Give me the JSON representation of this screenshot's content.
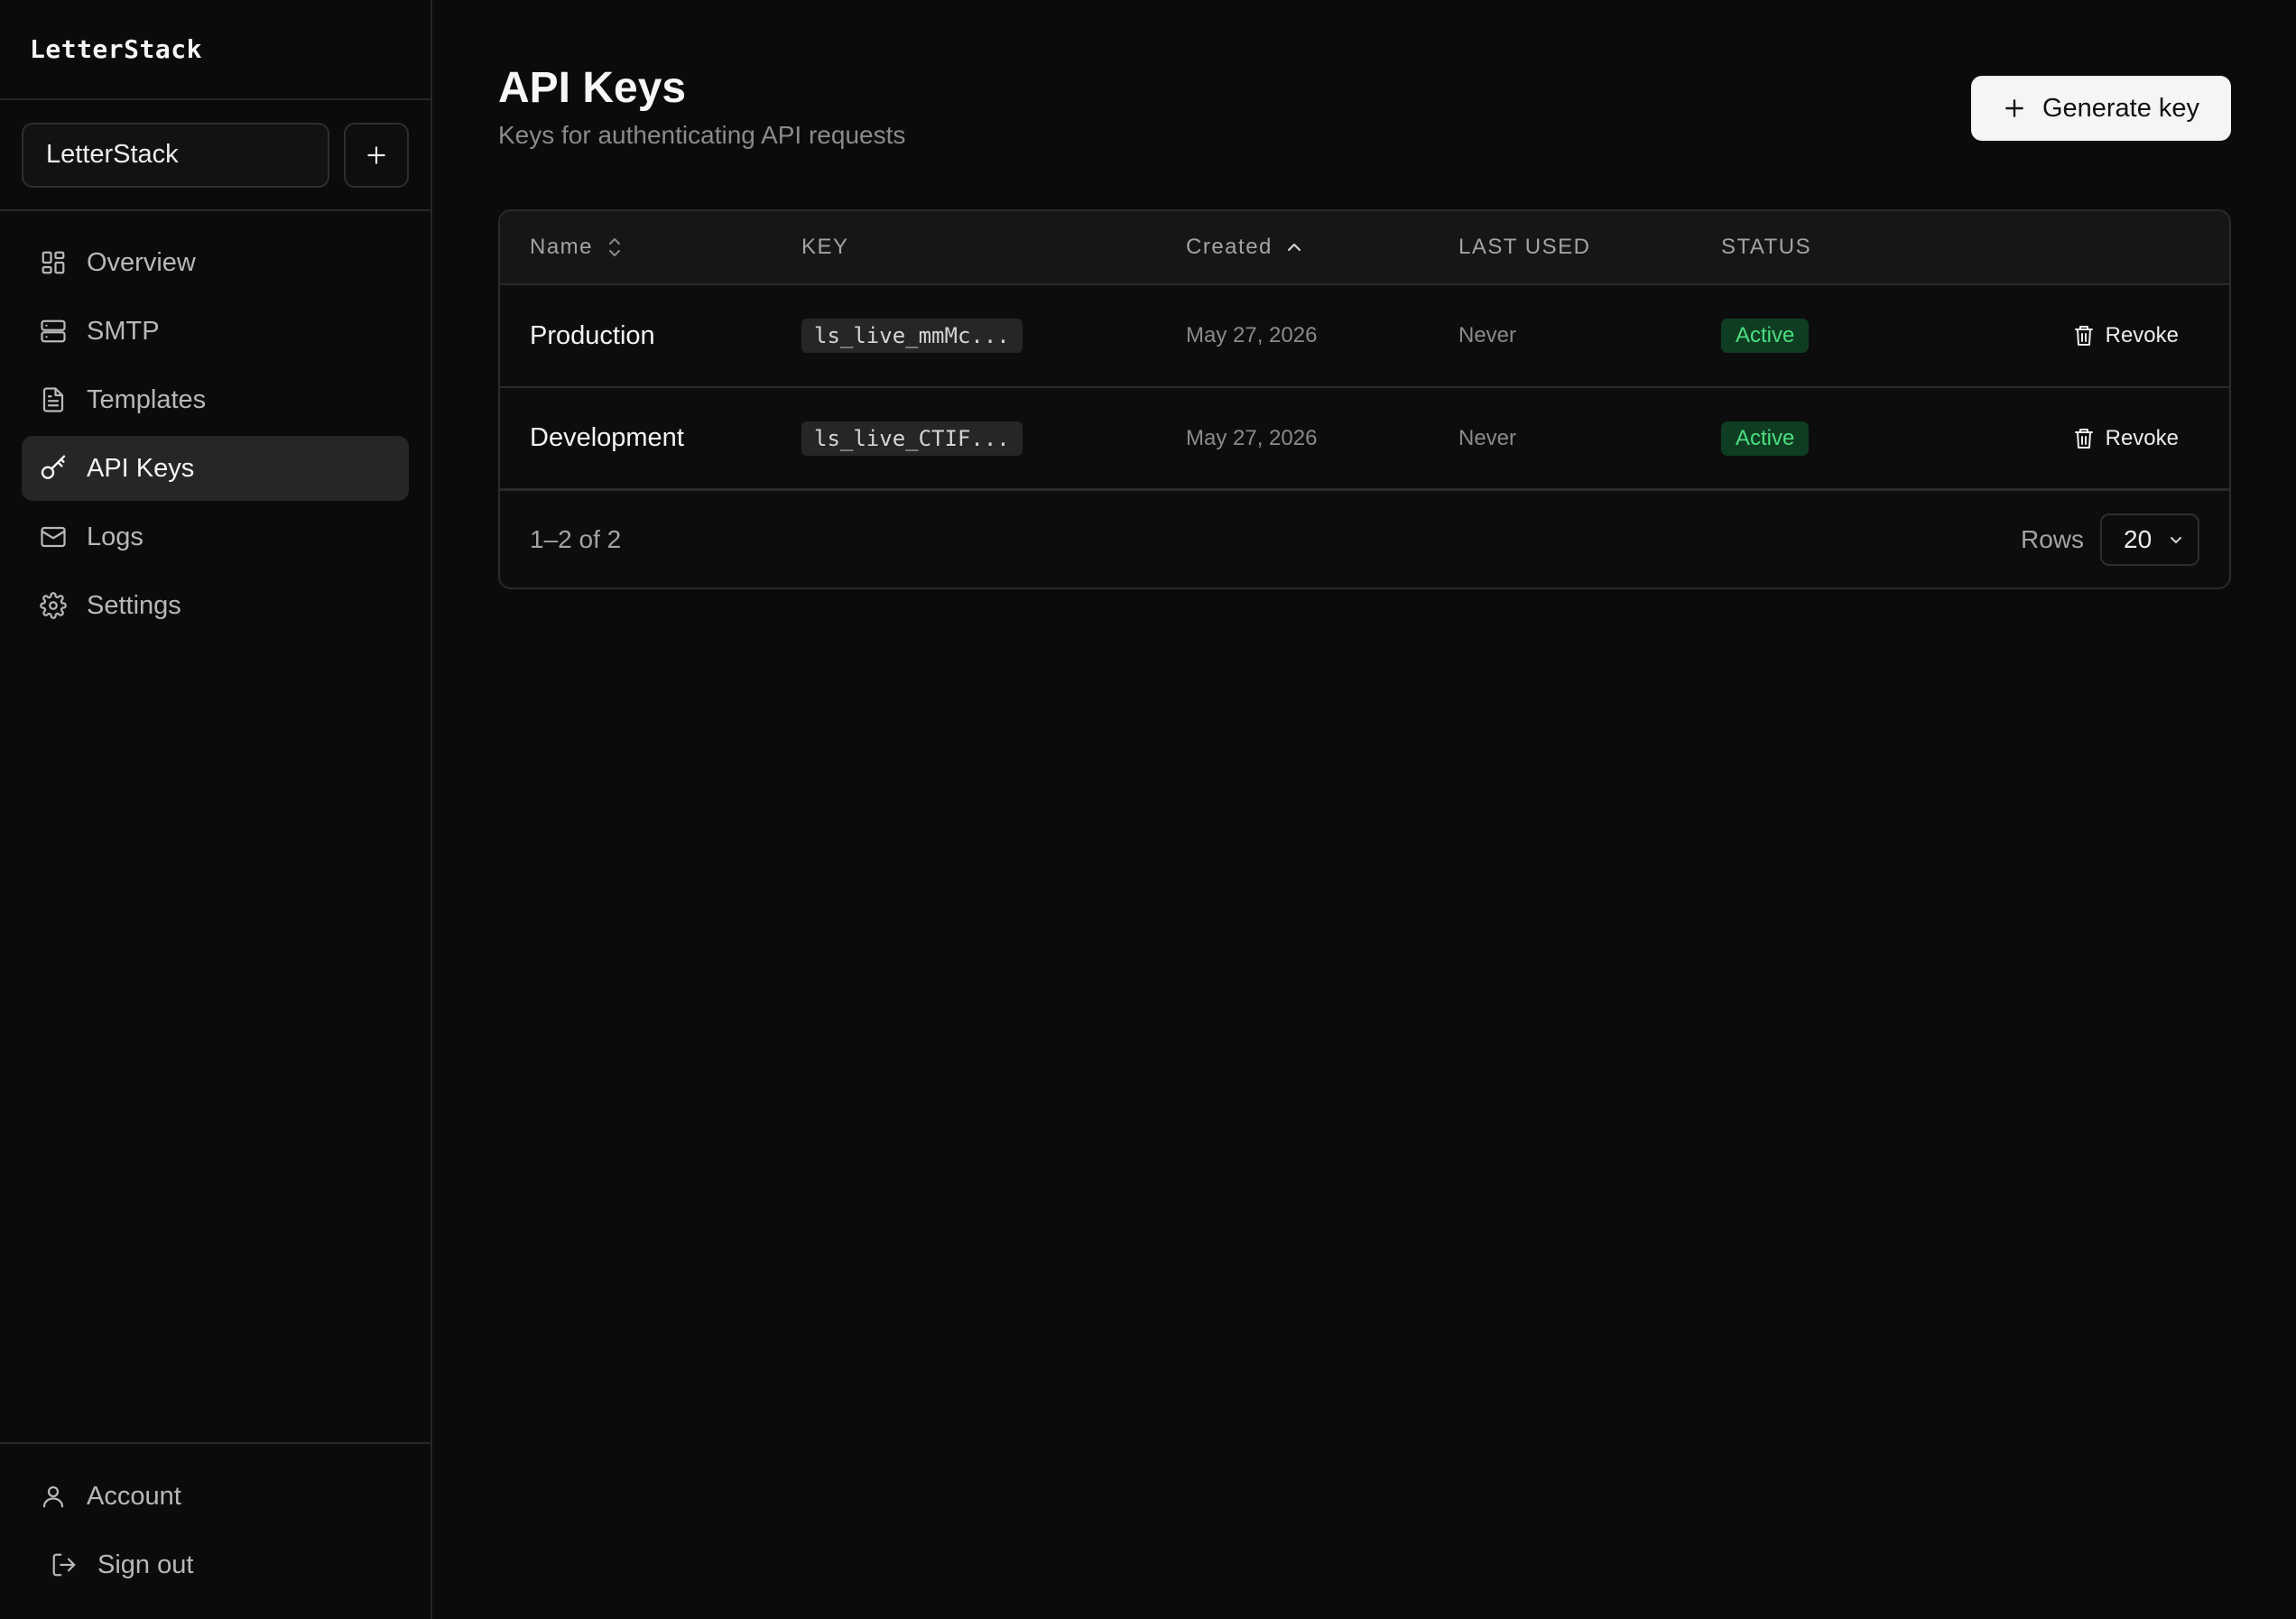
{
  "brand": {
    "name": "LetterStack"
  },
  "project": {
    "selected": "LetterStack",
    "add_icon": "plus-icon"
  },
  "sidebar": {
    "items": [
      {
        "label": "Overview",
        "icon": "layout-grid-icon",
        "active": false
      },
      {
        "label": "SMTP",
        "icon": "server-icon",
        "active": false
      },
      {
        "label": "Templates",
        "icon": "file-text-icon",
        "active": false
      },
      {
        "label": "API Keys",
        "icon": "key-icon",
        "active": true
      },
      {
        "label": "Logs",
        "icon": "mail-icon",
        "active": false
      },
      {
        "label": "Settings",
        "icon": "gear-icon",
        "active": false
      }
    ],
    "bottom": [
      {
        "label": "Account",
        "icon": "user-icon"
      },
      {
        "label": "Sign out",
        "icon": "sign-out-icon"
      }
    ]
  },
  "header": {
    "title": "API Keys",
    "subtitle": "Keys for authenticating API requests",
    "generate_label": "Generate key"
  },
  "table": {
    "columns": {
      "name": "Name",
      "key": "KEY",
      "created": "Created",
      "last_used": "LAST USED",
      "status": "STATUS"
    },
    "rows": [
      {
        "name": "Production",
        "key": "ls_live_mmMc...",
        "created": "May 27, 2026",
        "last_used": "Never",
        "status": "Active",
        "action": "Revoke"
      },
      {
        "name": "Development",
        "key": "ls_live_CTIF...",
        "created": "May 27, 2026",
        "last_used": "Never",
        "status": "Active",
        "action": "Revoke"
      }
    ],
    "footer": {
      "range": "1–2 of 2",
      "rows_label": "Rows",
      "rows_value": "20"
    }
  },
  "colors": {
    "background": "#0b0b0b",
    "active_nav": "#262626",
    "badge_bg": "#0f3d22",
    "badge_text": "#4ade80",
    "primary_button": "#f5f5f5"
  }
}
